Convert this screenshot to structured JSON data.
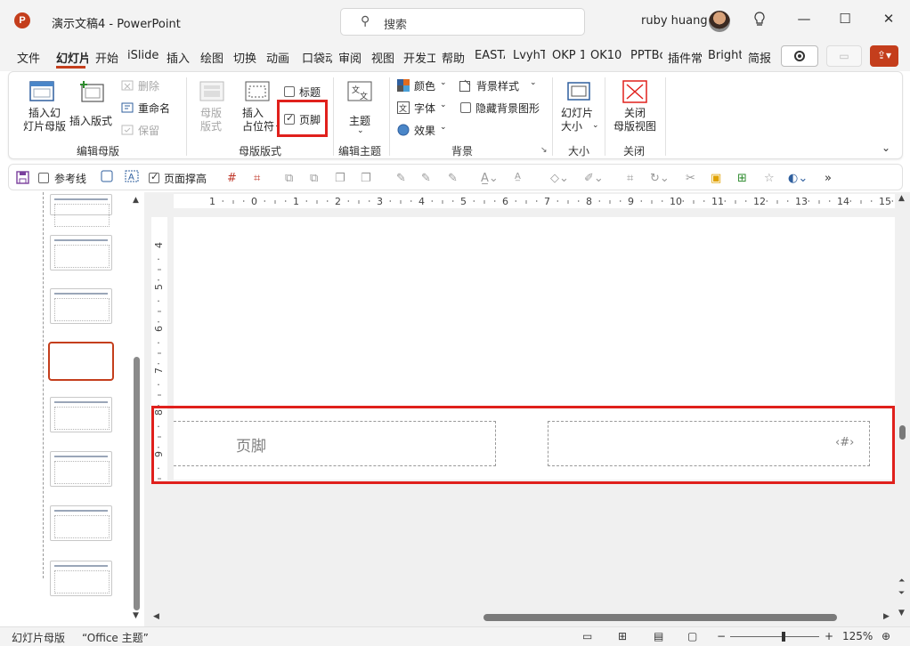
{
  "app": {
    "logo_letter": "P",
    "doc_title": "演示文稿4  -  PowerPoint",
    "search_placeholder": "搜索",
    "user_name": "ruby huang",
    "window": {
      "minimize": "—",
      "maximize": "☐",
      "close": "✕"
    }
  },
  "tabs": [
    {
      "label": "文件"
    },
    {
      "label": "幻灯片"
    },
    {
      "label": "开始"
    },
    {
      "label": "iSlide"
    },
    {
      "label": "插入"
    },
    {
      "label": "绘图"
    },
    {
      "label": "切换"
    },
    {
      "label": "动画"
    },
    {
      "label": "口袋动画"
    },
    {
      "label": "审阅"
    },
    {
      "label": "视图"
    },
    {
      "label": "开发工具"
    },
    {
      "label": "帮助"
    },
    {
      "label": "EASTAT"
    },
    {
      "label": "LvyhTools"
    },
    {
      "label": "OKP 1"
    },
    {
      "label": "OK10"
    },
    {
      "label": "PPTBoost"
    },
    {
      "label": "插件常"
    },
    {
      "label": "Bright"
    },
    {
      "label": "简报"
    }
  ],
  "ribbon": {
    "edit_master": {
      "insert_slide_master": "插入幻\n灯片母版",
      "insert_layout": "插入版式",
      "delete": "删除",
      "rename": "重命名",
      "preserve": "保留",
      "group_label": "编辑母版"
    },
    "master_layout": {
      "master_layout_button": "母版\n版式",
      "insert_placeholder": "插入\n占位符",
      "title_checkbox": "标题",
      "footer_checkbox": "页脚",
      "group_label": "母版版式"
    },
    "edit_theme": {
      "themes": "主题",
      "group_label": "编辑主题"
    },
    "background": {
      "colors": "颜色",
      "fonts": "字体",
      "effects": "效果",
      "background_styles": "背景样式",
      "hide_background_graphics": "隐藏背景图形",
      "group_label": "背景"
    },
    "size": {
      "slide_size": "幻灯片\n大小",
      "group_label": "大小"
    },
    "close": {
      "close_master_view": "关闭\n母版视图",
      "group_label": "关闭"
    }
  },
  "qat": {
    "guides_checkbox": "参考线",
    "page_stretch_checkbox": "页面撑高"
  },
  "ruler": {
    "h_ticks": [
      "1",
      "0",
      "1",
      "2",
      "3",
      "4",
      "5",
      "6",
      "7",
      "8",
      "9",
      "10",
      "11",
      "12",
      "13",
      "14",
      "15"
    ],
    "v_ticks": [
      "4",
      "5",
      "6",
      "7",
      "8",
      "9"
    ]
  },
  "slide": {
    "footer_placeholder": "页脚",
    "slide_number_placeholder": "‹#›"
  },
  "status": {
    "view_name": "幻灯片母版",
    "theme_name": "“Office 主题”",
    "zoom_minus": "−",
    "zoom_plus": "+",
    "zoom_percent": "125%",
    "zoom_level": 0.6
  }
}
